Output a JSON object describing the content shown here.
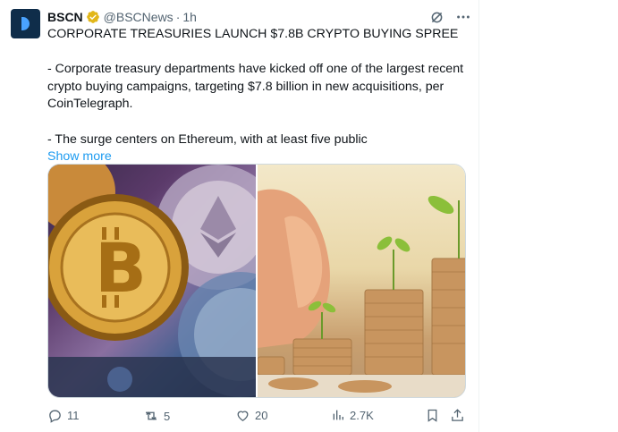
{
  "tweet": {
    "author_name": "BSCN",
    "handle": "@BSCNews",
    "separator": "·",
    "time": "1h",
    "headline": "CORPORATE TREASURIES LAUNCH $7.8B CRYPTO BUYING SPREE",
    "paragraph1": "- Corporate treasury departments have kicked off one of the largest recent crypto buying campaigns, targeting $7.8 billion in new acquisitions, per CoinTelegraph.",
    "paragraph2": "- The surge centers on Ethereum, with at least five public",
    "show_more": "Show more"
  },
  "footer": {
    "replies": "11",
    "reposts": "5",
    "likes": "20",
    "views": "2.7K"
  },
  "colors": {
    "accent": "#1d9bf0",
    "muted": "#536471",
    "verified": "#e2b719"
  }
}
